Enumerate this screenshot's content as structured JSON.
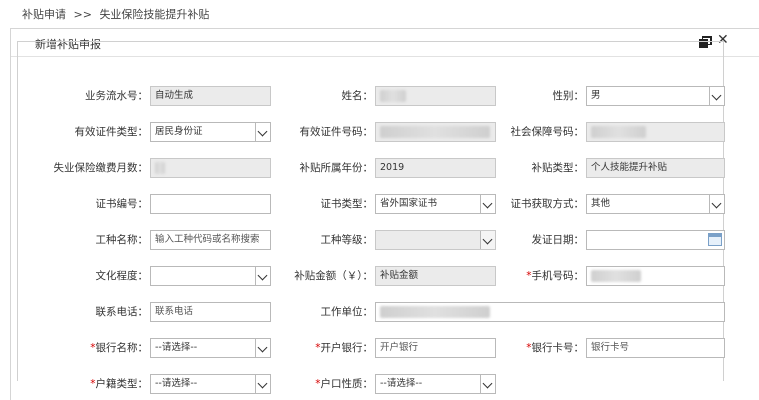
{
  "breadcrumb": {
    "root": "补贴申请",
    "sep": ">>",
    "current": "失业保险技能提升补贴"
  },
  "panel": {
    "title": "新增补贴申报"
  },
  "form": {
    "business_no": {
      "label": "业务流水号：",
      "value": "自动生成"
    },
    "name": {
      "label": "姓名："
    },
    "gender": {
      "label": "性别：",
      "value": "男"
    },
    "id_type": {
      "label": "有效证件类型：",
      "value": "居民身份证"
    },
    "id_number": {
      "label": "有效证件号码："
    },
    "social_no": {
      "label": "社会保障号码："
    },
    "months": {
      "label": "失业保险缴费月数："
    },
    "year": {
      "label": "补贴所属年份：",
      "value": "2019"
    },
    "subsidy_type": {
      "label": "补贴类型：",
      "value": "个人技能提升补贴"
    },
    "cert_no": {
      "label": "证书编号：",
      "value": ""
    },
    "cert_type": {
      "label": "证书类型：",
      "value": "省外国家证书"
    },
    "cert_method": {
      "label": "证书获取方式：",
      "value": "其他"
    },
    "job_name": {
      "label": "工种名称：",
      "value": "输入工种代码或名称搜索"
    },
    "job_level": {
      "label": "工种等级：",
      "value": ""
    },
    "issue_date": {
      "label": "发证日期：",
      "value": ""
    },
    "education": {
      "label": "文化程度：",
      "value": ""
    },
    "amount": {
      "label": "补贴金额（￥）：",
      "value": "补贴金额"
    },
    "mobile": {
      "label": "手机号码：",
      "star": "*"
    },
    "phone": {
      "label": "联系电话：",
      "value": "联系电话"
    },
    "work_unit": {
      "label": "工作单位："
    },
    "bank_name": {
      "label": "银行名称：",
      "star": "*",
      "value": "--请选择--"
    },
    "bank_branch": {
      "label": "开户银行：",
      "star": "*",
      "value": "开户银行"
    },
    "bank_card": {
      "label": "银行卡号：",
      "star": "*",
      "value": "银行卡号"
    },
    "household_type": {
      "label": "户籍类型：",
      "star": "*",
      "value": "--请选择--"
    },
    "household_nature": {
      "label": "户口性质：",
      "star": "*",
      "value": "--请选择--"
    }
  }
}
